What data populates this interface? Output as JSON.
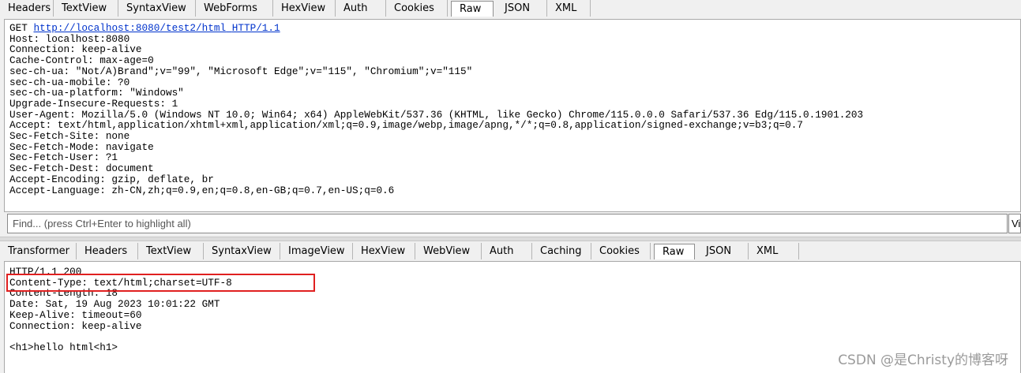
{
  "request_tabs": [
    "Headers",
    "TextView",
    "SyntaxView",
    "WebForms",
    "HexView",
    "Auth",
    "Cookies",
    "Raw",
    "JSON",
    "XML"
  ],
  "request_active_tab": "Raw",
  "request": {
    "method": "GET",
    "url": "http://localhost:8080/test2/html",
    "protocol": "HTTP/1.1",
    "headers": [
      "Host: localhost:8080",
      "Connection: keep-alive",
      "Cache-Control: max-age=0",
      "sec-ch-ua: \"Not/A)Brand\";v=\"99\", \"Microsoft Edge\";v=\"115\", \"Chromium\";v=\"115\"",
      "sec-ch-ua-mobile: ?0",
      "sec-ch-ua-platform: \"Windows\"",
      "Upgrade-Insecure-Requests: 1",
      "User-Agent: Mozilla/5.0 (Windows NT 10.0; Win64; x64) AppleWebKit/537.36 (KHTML, like Gecko) Chrome/115.0.0.0 Safari/537.36 Edg/115.0.1901.203",
      "Accept: text/html,application/xhtml+xml,application/xml;q=0.9,image/webp,image/apng,*/*;q=0.8,application/signed-exchange;v=b3;q=0.7",
      "Sec-Fetch-Site: none",
      "Sec-Fetch-Mode: navigate",
      "Sec-Fetch-User: ?1",
      "Sec-Fetch-Dest: document",
      "Accept-Encoding: gzip, deflate, br",
      "Accept-Language: zh-CN,zh;q=0.9,en;q=0.8,en-GB;q=0.7,en-US;q=0.6"
    ]
  },
  "find": {
    "placeholder": "Find... (press Ctrl+Enter to highlight all)",
    "button_label": "View in Notepad"
  },
  "response_tabs": [
    "Transformer",
    "Headers",
    "TextView",
    "SyntaxView",
    "ImageView",
    "HexView",
    "WebView",
    "Auth",
    "Caching",
    "Cookies",
    "Raw",
    "JSON",
    "XML"
  ],
  "response_active_tab": "Raw",
  "response": {
    "lines": [
      "HTTP/1.1 200",
      "Content-Type: text/html;charset=UTF-8",
      "Content-Length: 18",
      "Date: Sat, 19 Aug 2023 10:01:22 GMT",
      "Keep-Alive: timeout=60",
      "Connection: keep-alive",
      "",
      "<h1>hello html<h1>"
    ]
  },
  "watermark": "CSDN @是Christy的博客呀",
  "colors": {
    "highlight_box": "#e02020",
    "link": "#0033cc"
  }
}
